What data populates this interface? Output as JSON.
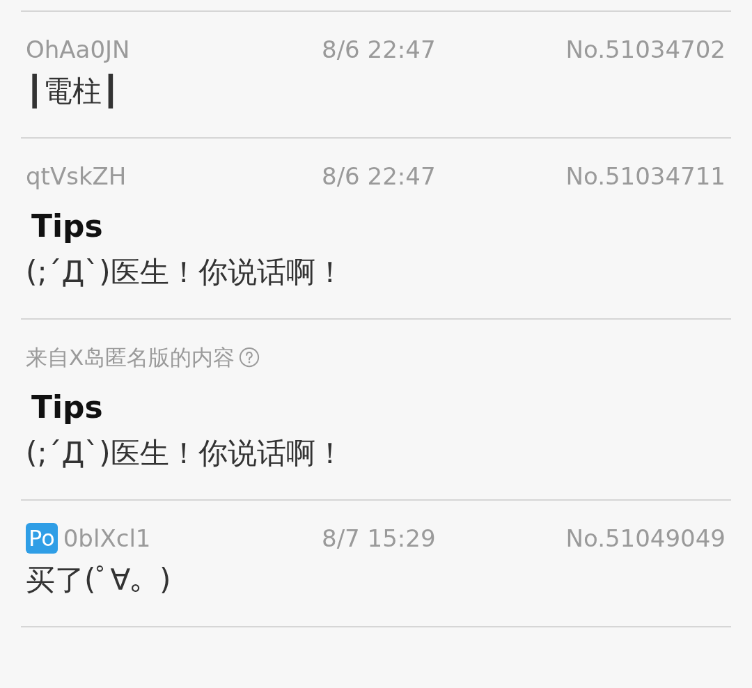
{
  "posts": [
    {
      "kind": "reply",
      "author": "OhAa0JN",
      "date": "8/6 22:47",
      "number": "No.51034702",
      "body": [
        {
          "kind": "text",
          "text": "┃電柱┃"
        }
      ]
    },
    {
      "kind": "reply",
      "author": "qtVskZH",
      "date": "8/6 22:47",
      "number": "No.51034711",
      "body": [
        {
          "kind": "title",
          "text": "Tips"
        },
        {
          "kind": "text",
          "text": "(;´Д`)医生！你说话啊！"
        }
      ]
    },
    {
      "kind": "notice",
      "label": "来自X岛匿名版的内容",
      "body": [
        {
          "kind": "title",
          "text": "Tips"
        },
        {
          "kind": "text",
          "text": "(;´Д`)医生！你说话啊！"
        }
      ]
    },
    {
      "kind": "reply",
      "badge": "Po",
      "author": "0blXcl1",
      "date": "8/7 15:29",
      "number": "No.51049049",
      "body": [
        {
          "kind": "text",
          "text": "买了(ﾟ∀。)"
        }
      ]
    }
  ]
}
